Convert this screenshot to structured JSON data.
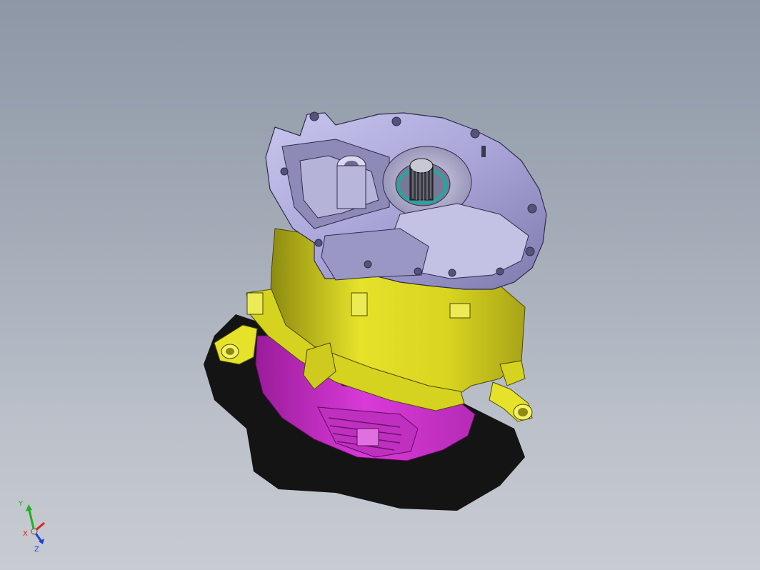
{
  "viewport": {
    "model_name": "",
    "colors": {
      "background_top": "#8d97a6",
      "background_bottom": "#c8cbd1",
      "gearbox_housing": "#a9a5d8",
      "motor_housing": "#e6e22a",
      "inverter_cover": "#d93ad9",
      "shadow": "#141414",
      "seal_ring": "#1faa9a"
    }
  },
  "triad": {
    "x_label": "X",
    "y_label": "Y",
    "z_label": "Z",
    "colors": {
      "x": "#e02020",
      "y": "#20b020",
      "z": "#2040e0"
    }
  }
}
